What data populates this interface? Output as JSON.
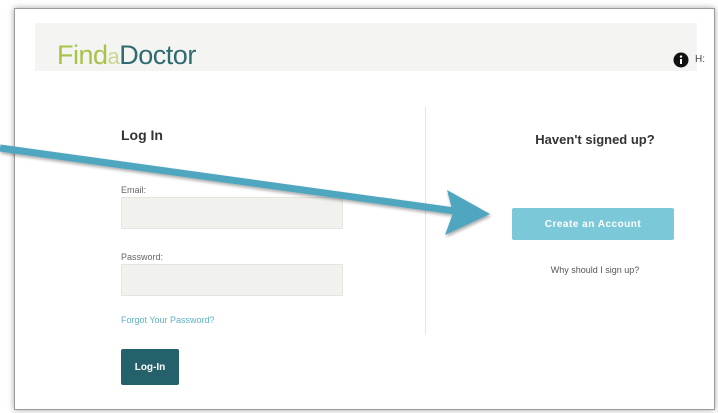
{
  "header": {
    "logo": {
      "find": "Find",
      "a": "a",
      "doctor": "Doctor"
    },
    "user_text": "H:"
  },
  "login": {
    "title": "Log In",
    "email_label": "Email:",
    "email_value": "",
    "password_label": "Password:",
    "password_value": "",
    "forgot_link": "Forgot Your Password?",
    "submit_label": "Log-In"
  },
  "signup": {
    "title": "Haven't signed up?",
    "create_button": "Create an Account",
    "why_link": "Why should I sign up?"
  },
  "colors": {
    "logo_green": "#a7c34a",
    "logo_teal": "#2f6b70",
    "login_button": "#24616a",
    "create_button": "#7bc8d8",
    "arrow": "#4fa6bf"
  },
  "icons": {
    "info": "info-icon"
  }
}
